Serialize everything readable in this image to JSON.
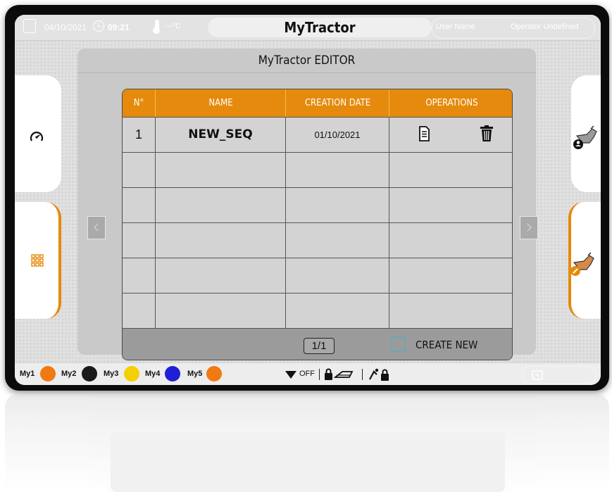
{
  "topbar": {
    "date": "04/10/2021",
    "time": "09:21",
    "temperature": "---°C",
    "app_title": "MyTractor",
    "user_name": "User Name",
    "operator": "Operator Undefined"
  },
  "panel": {
    "title": "MyTractor EDITOR"
  },
  "table": {
    "headers": [
      "N°",
      "NAME",
      "CREATION DATE",
      "OPERATIONS"
    ],
    "rows": [
      {
        "number": "1",
        "name": "NEW_SEQ",
        "date": "01/10/2021"
      }
    ],
    "empty_rows": 5
  },
  "footer": {
    "page": "1/1",
    "create_label": "CREATE NEW"
  },
  "bottombar": {
    "my1": "My1",
    "my2": "My2",
    "my3": "My3",
    "my4": "My4",
    "my5": "My5",
    "off_label": "OFF"
  },
  "colors": {
    "accent": "#e58a0c",
    "create_icon": "#3fb6c6",
    "my_blue": "#1f1fd6",
    "my_yellow": "#f4d000"
  },
  "icons": {
    "left_top": "speedometer-icon",
    "left_bottom": "grid-icon",
    "right_top": "tractor-user-icon",
    "right_bottom": "tractor-edit-icon",
    "operations": [
      "copy-document-icon",
      "trash-icon"
    ]
  }
}
